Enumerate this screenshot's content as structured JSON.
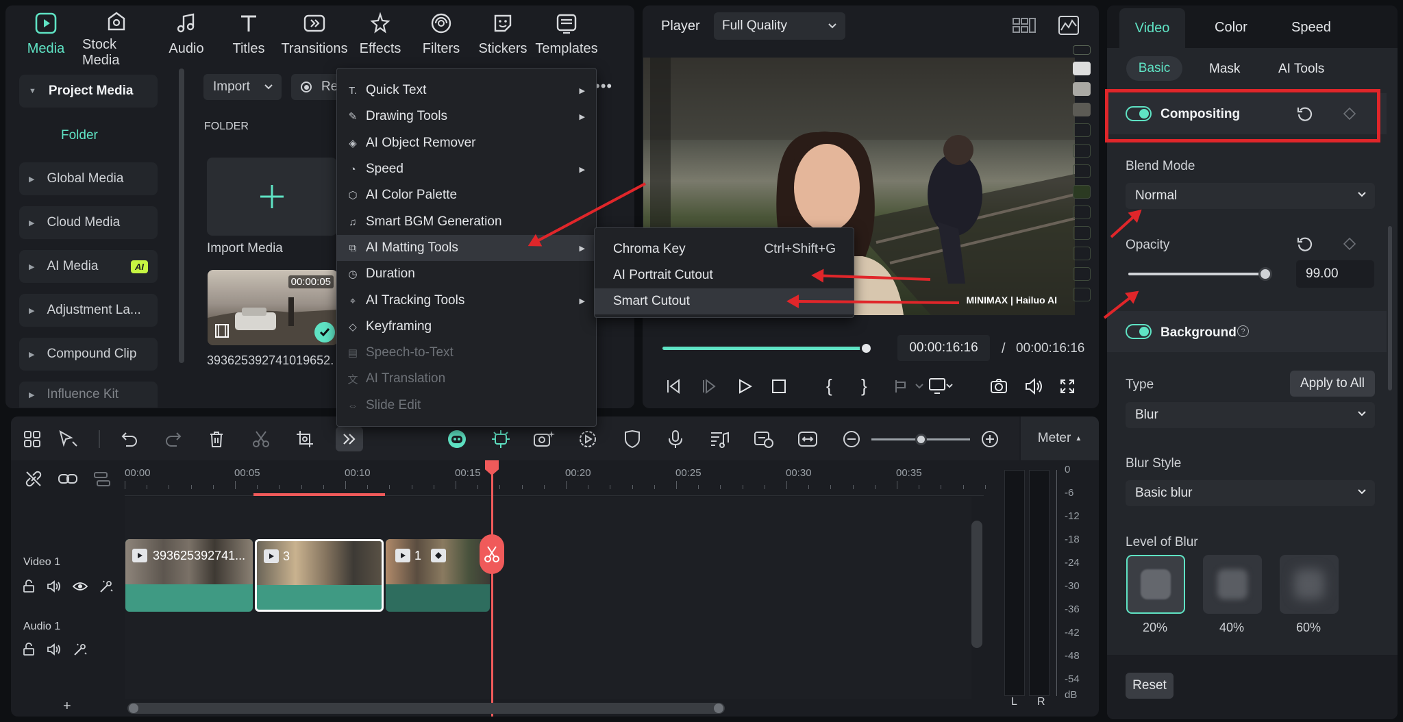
{
  "top_tabs": [
    {
      "label": "Media",
      "icon": "media-icon",
      "active": true
    },
    {
      "label": "Stock Media",
      "icon": "stock-media-icon"
    },
    {
      "label": "Audio",
      "icon": "music-note-icon"
    },
    {
      "label": "Titles",
      "icon": "text-t-icon"
    },
    {
      "label": "Transitions",
      "icon": "transitions-icon"
    },
    {
      "label": "Effects",
      "icon": "effects-star-icon"
    },
    {
      "label": "Filters",
      "icon": "filters-icon"
    },
    {
      "label": "Stickers",
      "icon": "stickers-icon"
    },
    {
      "label": "Templates",
      "icon": "templates-icon"
    }
  ],
  "sidebar": {
    "project_media": "Project Media",
    "folder": "Folder",
    "items": [
      {
        "label": "Global Media"
      },
      {
        "label": "Cloud Media"
      },
      {
        "label": "AI Media",
        "badge": "AI"
      },
      {
        "label": "Adjustment La..."
      },
      {
        "label": "Compound Clip"
      },
      {
        "label": "Influence Kit"
      }
    ]
  },
  "media": {
    "import_label": "Import",
    "record_label": "Re",
    "folder_heading": "FOLDER",
    "import_media_label": "Import Media",
    "clip_duration": "00:00:05",
    "clip_name": "393625392741019652..."
  },
  "context_menu": {
    "items": [
      {
        "label": "Quick Text",
        "icon": "quick-text-icon",
        "submenu": true
      },
      {
        "label": "Drawing Tools",
        "icon": "drawing-tools-icon",
        "submenu": true
      },
      {
        "label": "AI Object Remover",
        "icon": "object-remover-icon"
      },
      {
        "label": "Speed",
        "icon": "speed-icon",
        "submenu": true
      },
      {
        "label": "AI Color Palette",
        "icon": "color-palette-icon"
      },
      {
        "label": "Smart BGM Generation",
        "icon": "bgm-icon"
      },
      {
        "label": "AI Matting Tools",
        "icon": "matting-icon",
        "submenu": true,
        "highlighted": true
      },
      {
        "label": "Duration",
        "icon": "duration-clock-icon"
      },
      {
        "label": "AI Tracking Tools",
        "icon": "tracking-icon",
        "submenu": true
      },
      {
        "label": "Keyframing",
        "icon": "keyframe-icon"
      },
      {
        "label": "Speech-to-Text",
        "icon": "speech-to-text-icon",
        "disabled": true
      },
      {
        "label": "AI Translation",
        "icon": "translation-icon",
        "disabled": true
      },
      {
        "label": "Slide Edit",
        "icon": "slide-edit-icon",
        "disabled": true
      }
    ]
  },
  "submenu": {
    "items": [
      {
        "label": "Chroma Key",
        "shortcut": "Ctrl+Shift+G"
      },
      {
        "label": "AI Portrait Cutout",
        "shortcut": ""
      },
      {
        "label": "Smart Cutout",
        "shortcut": "",
        "highlighted": true
      }
    ]
  },
  "player": {
    "label": "Player",
    "quality": "Full Quality",
    "current_time": "00:00:16:16",
    "separator": "/",
    "total_time": "00:00:16:16",
    "progress": 0.98,
    "watermark": "MINIMAX | Hailuo AI"
  },
  "right_panel": {
    "tabs": [
      "Video",
      "Color",
      "Speed"
    ],
    "active_tab": "Video",
    "subtabs": [
      "Basic",
      "Mask",
      "AI Tools"
    ],
    "active_subtab": "Basic",
    "compositing_label": "Compositing",
    "blend_mode_label": "Blend Mode",
    "blend_mode_value": "Normal",
    "opacity_label": "Opacity",
    "opacity_value": "99.00",
    "opacity_fraction": 0.99,
    "background_label": "Background",
    "type_label": "Type",
    "apply_all_label": "Apply to All",
    "type_value": "Blur",
    "blur_style_label": "Blur Style",
    "blur_style_value": "Basic blur",
    "level_label": "Level of Blur",
    "blur_levels": [
      "20%",
      "40%",
      "60%"
    ],
    "selected_level": "20%",
    "reset_label": "Reset"
  },
  "timeline": {
    "meter_label": "Meter",
    "ruler": [
      "00:00",
      "00:05",
      "00:10",
      "00:15",
      "00:20",
      "00:25",
      "00:30",
      "00:35"
    ],
    "tracks": [
      {
        "label": "Video 1"
      },
      {
        "label": "Audio 1"
      }
    ],
    "clips": [
      {
        "label": "393625392741..."
      },
      {
        "label": "3"
      },
      {
        "label": "1"
      }
    ],
    "db_scale": [
      "0",
      "-6",
      "-12",
      "-18",
      "-24",
      "-30",
      "-36",
      "-42",
      "-48",
      "-54",
      "dB"
    ],
    "lr": [
      "L",
      "R"
    ],
    "add_track": "+"
  },
  "colors": {
    "accent": "#5fe3c4",
    "playhead": "#f05a5a",
    "annotation": "#e0262a"
  }
}
